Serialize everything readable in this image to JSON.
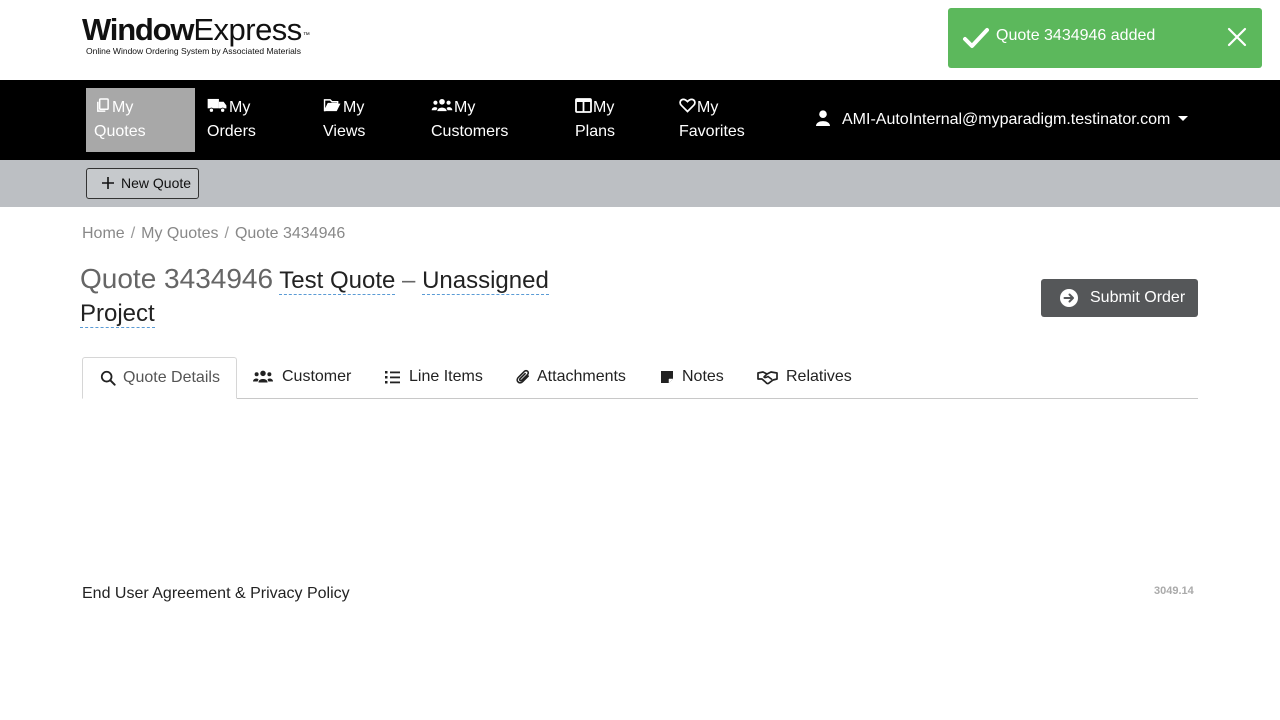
{
  "brand": {
    "name_bold": "Window",
    "name_regular": "Express",
    "trademark": "™",
    "tagline": "Online Window Ordering System by Associated Materials"
  },
  "toast": {
    "message": "Quote 3434946 added",
    "color": "#5cb85c"
  },
  "nav": {
    "items": [
      {
        "line1": "My",
        "line2": "Quotes",
        "icon": "copy-icon",
        "active": true
      },
      {
        "line1": "My",
        "line2": "Orders",
        "icon": "truck-icon",
        "active": false
      },
      {
        "line1": "My",
        "line2": "Views",
        "icon": "folder-open-icon",
        "active": false
      },
      {
        "line1": "My",
        "line2": "Customers",
        "icon": "users-icon",
        "active": false
      },
      {
        "line1": "My",
        "line2": "Plans",
        "icon": "columns-icon",
        "active": false
      },
      {
        "line1": "My",
        "line2": "Favorites",
        "icon": "heart-icon",
        "active": false
      }
    ],
    "user_email": "AMI-AutoInternal@myparadigm.testinator.com"
  },
  "toolbar": {
    "new_quote_label": "New Quote"
  },
  "breadcrumb": {
    "home": "Home",
    "section": "My Quotes",
    "current": "Quote 3434946"
  },
  "quote": {
    "number_label": "Quote 3434946",
    "name": "Test Quote",
    "separator": "–",
    "project_line1": "Unassigned",
    "project_line2": "Project"
  },
  "actions": {
    "submit_label": "Submit Order"
  },
  "tabs": [
    {
      "label": "Quote Details",
      "icon": "search-icon",
      "active": true
    },
    {
      "label": "Customer",
      "icon": "users-icon",
      "active": false
    },
    {
      "label": "Line Items",
      "icon": "list-icon",
      "active": false
    },
    {
      "label": "Attachments",
      "icon": "paperclip-icon",
      "active": false
    },
    {
      "label": "Notes",
      "icon": "sticky-note-icon",
      "active": false
    },
    {
      "label": "Relatives",
      "icon": "handshake-icon",
      "active": false
    }
  ],
  "footer": {
    "agreement_link": "End User Agreement & Privacy Policy",
    "version": "3049.14"
  }
}
